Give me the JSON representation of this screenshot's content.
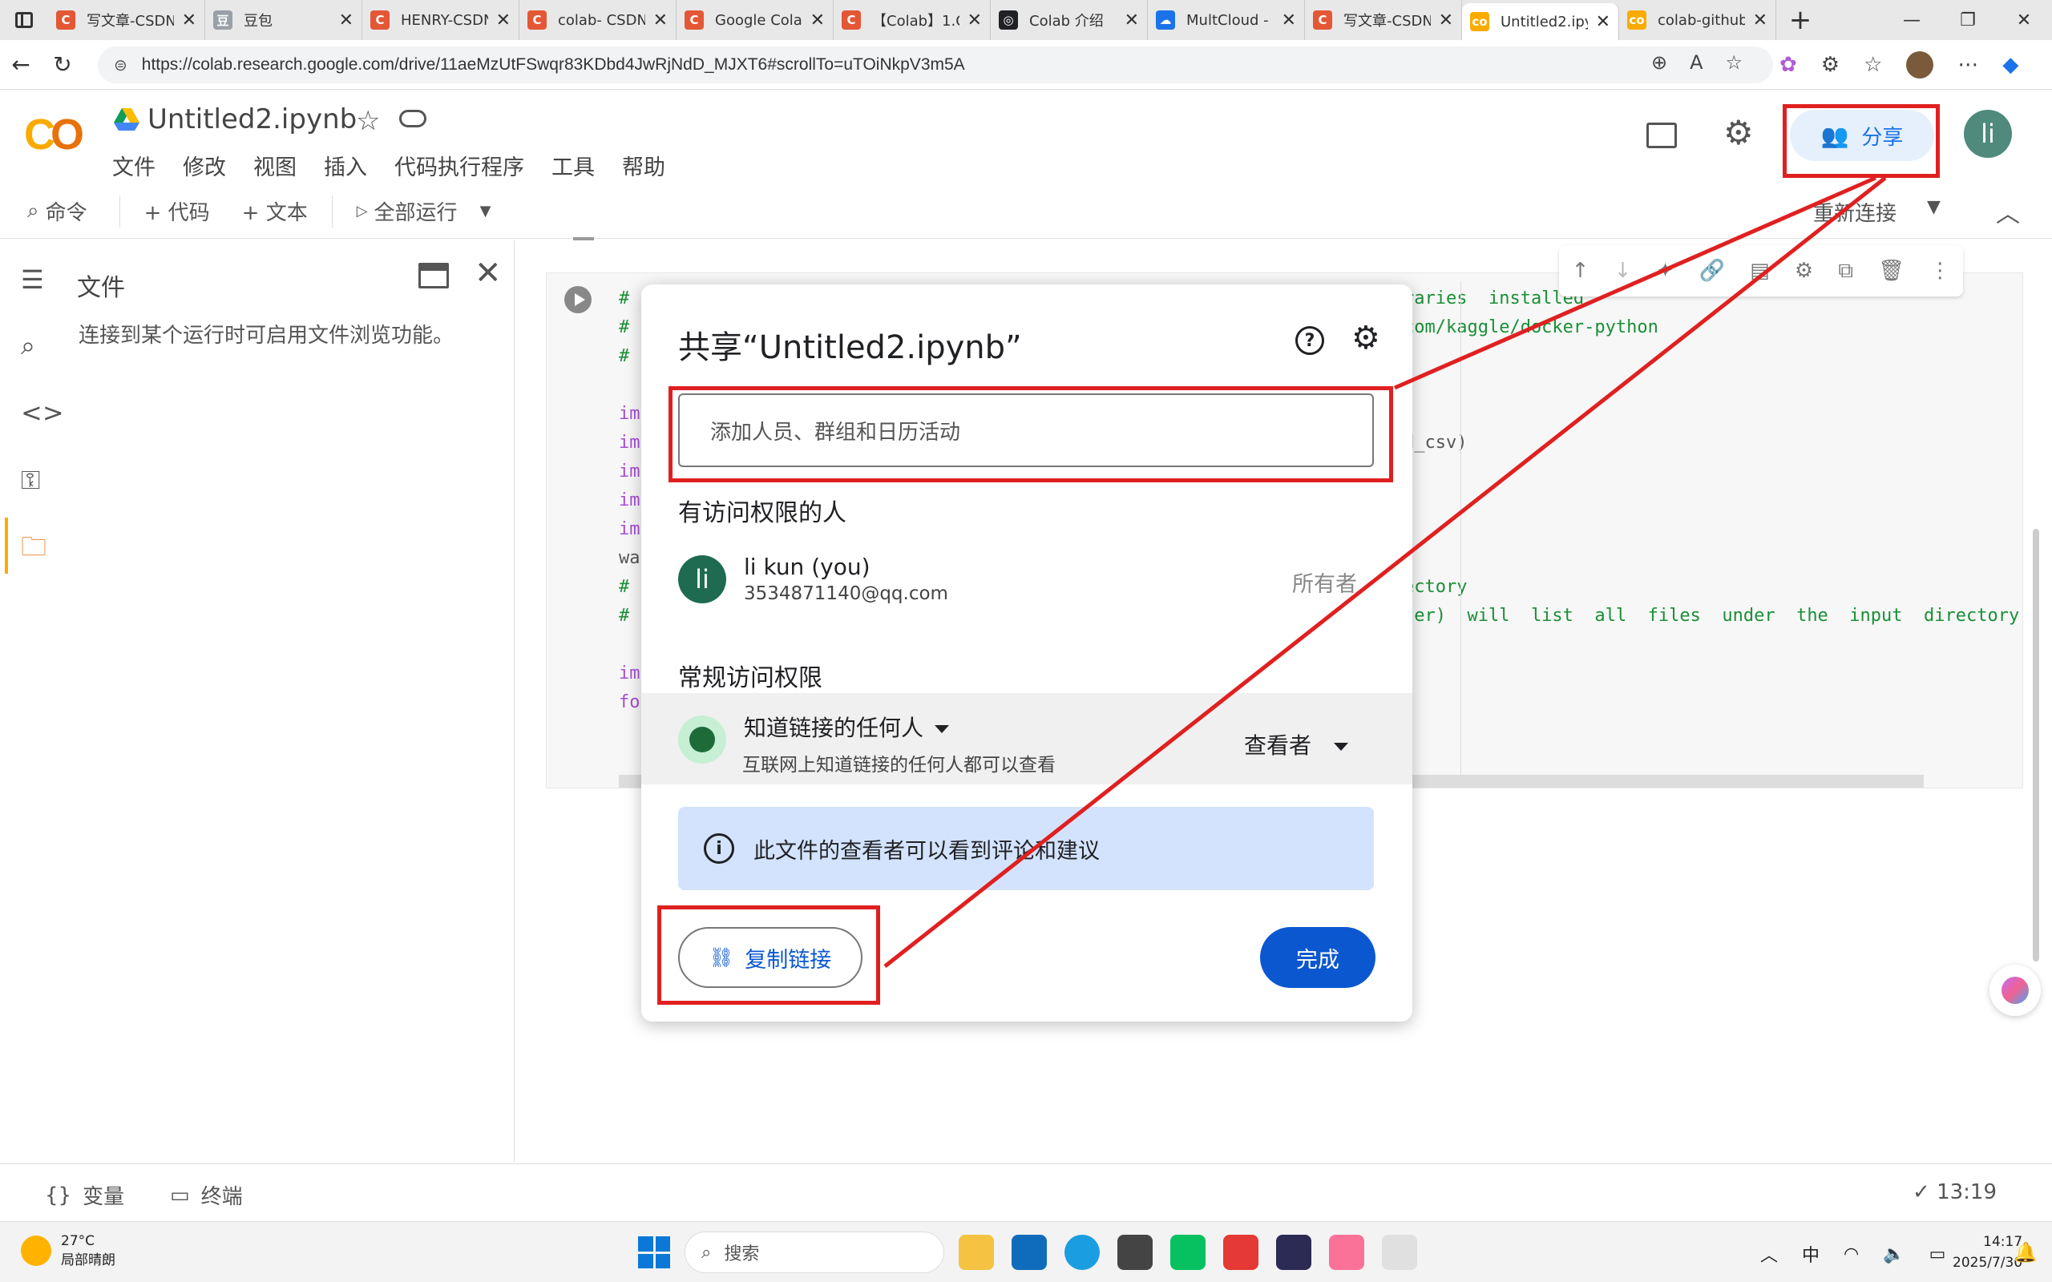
{
  "browser": {
    "tabs": [
      {
        "title": "写文章-CSDN",
        "fav_color": "#e45735",
        "fav_letter": "C"
      },
      {
        "title": "豆包",
        "fav_color": "#9aa0a6",
        "fav_letter": "豆"
      },
      {
        "title": "HENRY-CSDN",
        "fav_color": "#e45735",
        "fav_letter": "C"
      },
      {
        "title": "colab- CSDN",
        "fav_color": "#e45735",
        "fav_letter": "C"
      },
      {
        "title": "Google Colal",
        "fav_color": "#e45735",
        "fav_letter": "C"
      },
      {
        "title": "【Colab】1.C",
        "fav_color": "#e45735",
        "fav_letter": "C"
      },
      {
        "title": "Colab 介绍",
        "fav_color": "#202124",
        "fav_letter": "◎"
      },
      {
        "title": "MultCloud -",
        "fav_color": "#1a73e8",
        "fav_letter": "☁"
      },
      {
        "title": "写文章-CSDN",
        "fav_color": "#e45735",
        "fav_letter": "C"
      },
      {
        "title": "Untitled2.ipy",
        "fav_color": "#f9ab00",
        "fav_letter": "co"
      },
      {
        "title": "colab-github",
        "fav_color": "#f9ab00",
        "fav_letter": "co"
      }
    ],
    "new_tab": "+",
    "url": "https://colab.research.google.com/drive/11aeMzUtFSwqr83KDbd4JwRjNdD_MJXT6#scrollTo=uTOiNkpV3m5A"
  },
  "colab": {
    "notebook_title": "Untitled2.ipynb",
    "menus": [
      "文件",
      "修改",
      "视图",
      "插入",
      "代码执行程序",
      "工具",
      "帮助"
    ],
    "share_label": "分享",
    "avatar_letter": "li",
    "toolbar": {
      "command": "命令",
      "add_code": "+ 代码",
      "add_text": "+ 文本",
      "run_all": "全部运行",
      "reconnect": "重新连接"
    }
  },
  "sidebar": {
    "panel_title": "文件",
    "message": "连接到某个运行时可启用文件浏览功能。"
  },
  "code_cell": {
    "left_lines": [
      {
        "text": "#",
        "cls": "c-green"
      },
      {
        "text": "#",
        "cls": "c-green"
      },
      {
        "text": "#",
        "cls": "c-green"
      },
      {
        "text": " ",
        "cls": "c-dark"
      },
      {
        "text": "imp",
        "cls": "c-purple"
      },
      {
        "text": "imp",
        "cls": "c-purple"
      },
      {
        "text": "imp",
        "cls": "c-purple"
      },
      {
        "text": "imp",
        "cls": "c-purple"
      },
      {
        "text": "imp",
        "cls": "c-purple"
      },
      {
        "text": "war",
        "cls": "c-dark"
      },
      {
        "text": "#",
        "cls": "c-green"
      },
      {
        "text": "#",
        "cls": "c-green"
      },
      {
        "text": " ",
        "cls": "c-dark"
      },
      {
        "text": "imp",
        "cls": "c-purple"
      },
      {
        "text": "fol",
        "cls": "c-purple"
      }
    ],
    "right_lines": [
      {
        "text": "raries  installed",
        "cls": "c-green"
      },
      {
        "text": "com/kaggle/docker-python",
        "cls": "c-green"
      },
      {
        "text": " ",
        "cls": "c-dark"
      },
      {
        "text": " ",
        "cls": "c-dark"
      },
      {
        "text": " ",
        "cls": "c-dark"
      },
      {
        "text": "d_csv)",
        "cls": "c-dark"
      },
      {
        "text": " ",
        "cls": "c-dark"
      },
      {
        "text": " ",
        "cls": "c-dark"
      },
      {
        "text": " ",
        "cls": "c-dark"
      },
      {
        "text": " ",
        "cls": "c-dark"
      },
      {
        "text": "ectory",
        "cls": "c-green"
      },
      {
        "text": "ter)  will  list  all  files  under  the  input  directory",
        "cls": "c-green"
      }
    ]
  },
  "share_dialog": {
    "title": "共享“Untitled2.ipynb”",
    "add_placeholder": "添加人员、群组和日历活动",
    "people_section": "有访问权限的人",
    "person": {
      "avatar": "li",
      "name": "li kun (you)",
      "email": "3534871140@qq.com",
      "role": "所有者"
    },
    "general_section": "常规访问权限",
    "access": {
      "scope": "知道链接的任何人",
      "description": "互联网上知道链接的任何人都可以查看",
      "role": "查看者"
    },
    "info": "此文件的查看者可以看到评论和建议",
    "copy_link": "复制链接",
    "done": "完成"
  },
  "statusbar": {
    "variables": "变量",
    "terminal": "终端",
    "time": "13:19"
  },
  "taskbar": {
    "temperature": "27°C",
    "weather": "局部晴朗",
    "search": "搜索",
    "ime": "中",
    "clock_time": "14:17",
    "clock_date": "2025/7/30"
  },
  "annotation_color": "#e02020"
}
